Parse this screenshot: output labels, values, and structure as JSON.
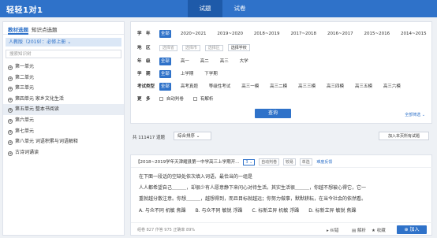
{
  "app": {
    "logo": "轻轻1对1"
  },
  "top_tabs": [
    {
      "label": "试题",
      "active": true
    },
    {
      "label": "试卷",
      "active": false
    }
  ],
  "sidebar": {
    "tabs": [
      {
        "label": "教材选题",
        "active": true
      },
      {
        "label": "知识点选题",
        "active": false
      }
    ],
    "version": "人教版（2019）：必修上册",
    "search_placeholder": "搜索知识树",
    "items": [
      {
        "label": "第一单元",
        "active": false
      },
      {
        "label": "第二单元",
        "active": false
      },
      {
        "label": "第三单元",
        "active": false
      },
      {
        "label": "第四单元 家乡文化生活",
        "active": false
      },
      {
        "label": "第五单元 整本书阅读",
        "active": true
      },
      {
        "label": "第六单元",
        "active": false
      },
      {
        "label": "第七单元",
        "active": false
      },
      {
        "label": "第八单元 词语积累与词语解释",
        "active": false
      },
      {
        "label": "古诗词诵读",
        "active": false
      }
    ]
  },
  "filters": {
    "year": {
      "label": "学　年",
      "options": [
        "全部",
        "2020~2021",
        "2019~2020",
        "2018~2019",
        "2017~2018",
        "2016~2017",
        "2015~2016",
        "2014~2015"
      ]
    },
    "region": {
      "label": "地　区",
      "selects": [
        "选择省",
        "选择市",
        "选择区"
      ],
      "button": "选择学校"
    },
    "grade": {
      "label": "年　级",
      "options": [
        "全部",
        "高一",
        "高二",
        "高三",
        "大学"
      ]
    },
    "semester": {
      "label": "学　期",
      "options": [
        "全部",
        "上学期",
        "下学期"
      ]
    },
    "exam_type": {
      "label": "考试类型",
      "options": [
        "全部",
        "高考真题",
        "等级性考试",
        "高三一模",
        "高三二模",
        "高三三模",
        "高三四模",
        "高三五模",
        "高三六模"
      ]
    },
    "more": {
      "label": "更　多",
      "checks": [
        "自动判卷",
        "有解析"
      ]
    },
    "query_button": "查询",
    "all_filters": "全部筛选 ⌄"
  },
  "results": {
    "total": "共 111417 道题",
    "sort": "综合排序",
    "add_all": "加入本页所有试题"
  },
  "question": {
    "source": "【2018~2019学年天津耀县第一中学高三上学期开…",
    "score": "3",
    "tags": [
      "自动判卷",
      "较易",
      "单选"
    ],
    "difficulty": "难度反馈",
    "lines": [
      "在下面一段话的空缺处依次填入词语，最恰当的一组是",
      "人人都希望自己＿＿＿，却很少有人愿意静下来问心对待生活。其实生活很＿＿＿，你越不想被心得它，它一",
      "重就越分散注意。你想＿＿＿，越想得到，而且目标就越远；你努力做事，默默耕耘，在当今社会的依然看。",
      "A. 与众不同  机敏  焦躁　　B. 与众不同  敏锐  浮躁　　C. 标新立异  机敏  浮躁　　D. 标新立异  敏锐  焦躁"
    ],
    "stats": "组卷 827  作答 975  正确率 89%",
    "actions": [
      "纠错",
      "解析",
      "收藏"
    ],
    "add_button": "加入"
  },
  "colors": {
    "brand": "#2f72c9",
    "background": "#eef1f5"
  }
}
